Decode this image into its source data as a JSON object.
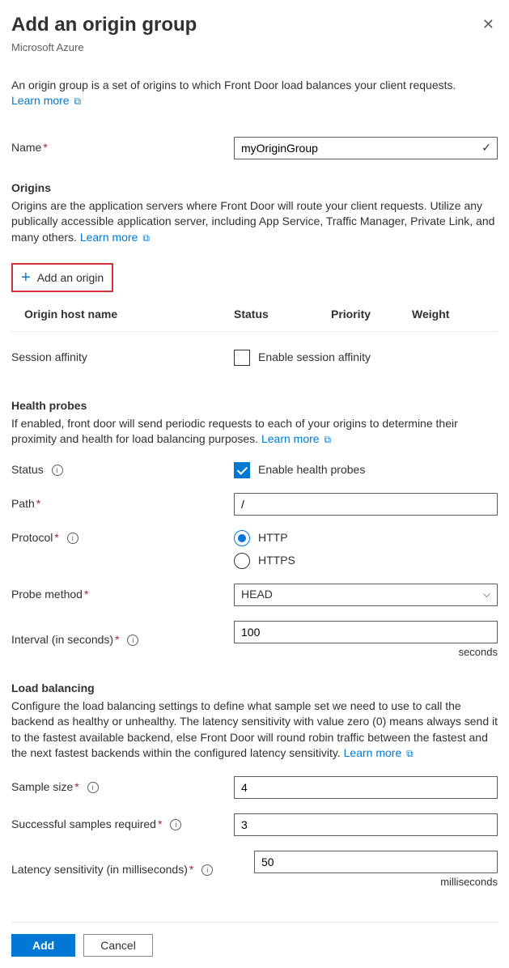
{
  "header": {
    "title": "Add an origin group",
    "subtitle": "Microsoft Azure"
  },
  "intro": {
    "text": "An origin group is a set of origins to which Front Door load balances your client requests.",
    "learn_more": "Learn more"
  },
  "name": {
    "label": "Name",
    "value": "myOriginGroup"
  },
  "origins": {
    "heading": "Origins",
    "desc": "Origins are the application servers where Front Door will route your client requests. Utilize any publically accessible application server, including App Service, Traffic Manager, Private Link, and many others.",
    "learn_more": "Learn more",
    "add_button": "Add an origin",
    "columns": {
      "host": "Origin host name",
      "status": "Status",
      "priority": "Priority",
      "weight": "Weight"
    }
  },
  "session_affinity": {
    "label": "Session affinity",
    "checkbox_label": "Enable session affinity"
  },
  "health_probes": {
    "heading": "Health probes",
    "desc": "If enabled, front door will send periodic requests to each of your origins to determine their proximity and health for load balancing purposes.",
    "learn_more": "Learn more",
    "status_label": "Status",
    "enable_label": "Enable health probes",
    "path_label": "Path",
    "path_value": "/",
    "protocol_label": "Protocol",
    "protocol_http": "HTTP",
    "protocol_https": "HTTPS",
    "probe_method_label": "Probe method",
    "probe_method_value": "HEAD",
    "interval_label": "Interval (in seconds)",
    "interval_value": "100",
    "interval_unit": "seconds"
  },
  "load_balancing": {
    "heading": "Load balancing",
    "desc": "Configure the load balancing settings to define what sample set we need to use to call the backend as healthy or unhealthy. The latency sensitivity with value zero (0) means always send it to the fastest available backend, else Front Door will round robin traffic between the fastest and the next fastest backends within the configured latency sensitivity.",
    "learn_more": "Learn more",
    "sample_size_label": "Sample size",
    "sample_size_value": "4",
    "successful_samples_label": "Successful samples required",
    "successful_samples_value": "3",
    "latency_label": "Latency sensitivity (in milliseconds)",
    "latency_value": "50",
    "latency_unit": "milliseconds"
  },
  "footer": {
    "add": "Add",
    "cancel": "Cancel"
  }
}
